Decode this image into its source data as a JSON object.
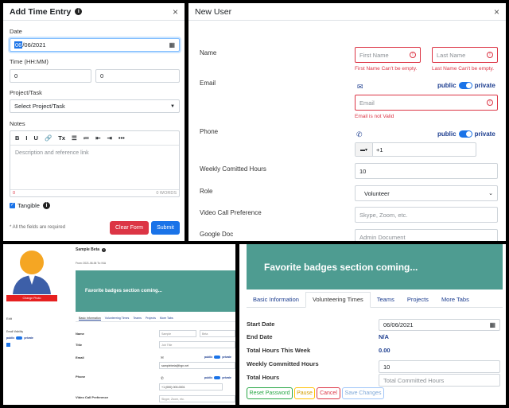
{
  "time_entry": {
    "title": "Add Time Entry",
    "close": "×",
    "date_label": "Date",
    "date_day": "06",
    "date_rest": "/06/2021",
    "time_label": "Time (HH:MM)",
    "hours": "0",
    "minutes": "0",
    "project_label": "Project/Task",
    "project_placeholder": "Select Project/Task",
    "notes_label": "Notes",
    "notes_placeholder": "Description and reference link",
    "char_count": "0",
    "word_count": "0 WORDS",
    "tangible_label": "Tangible",
    "required_note": "* All the fields are required",
    "clear_label": "Clear Form",
    "submit_label": "Submit",
    "toolbar": [
      "B",
      "I",
      "U",
      "🔗",
      "Tx",
      "☰",
      "≔",
      "⇤",
      "⇥",
      "•••"
    ]
  },
  "new_user": {
    "title": "New User",
    "close": "×",
    "name_label": "Name",
    "first_placeholder": "First Name",
    "last_placeholder": "Last Name",
    "first_error": "First Name Can't be empty.",
    "last_error": "Last Name Can't be empty.",
    "email_label": "Email",
    "public_label": "public",
    "private_label": "private",
    "email_placeholder": "Email",
    "email_error": "Email is not Valid",
    "phone_label": "Phone",
    "phone_code": "+1",
    "weekly_label": "Weekly Comitted Hours",
    "weekly_value": "10",
    "role_label": "Role",
    "role_value": "Volunteer",
    "video_label": "Video Call Preference",
    "video_placeholder": "Skype, Zoom, etc.",
    "gdoc_label": "Google Doc",
    "gdoc_placeholder": "Admin Document"
  },
  "profile_small": {
    "change_photo": "Change Photo",
    "name": "Sample Beta",
    "joined": "From: 2021-06-06 To: N/A",
    "badges_text": "Favorite badges section coming...",
    "tabs": [
      "Basic Information",
      "Volunteering Times",
      "Teams",
      "Projects",
      "More Tabs"
    ],
    "rows": [
      "Name",
      "Title",
      "Email",
      "Phone",
      "Video Call Preference"
    ],
    "first": "Sample",
    "last": "Beta",
    "title_ph": "Job Title",
    "email_val": "samplebeta@hgn.net",
    "phone_val": "+1 (000) 000-0001",
    "video_ph": "Skype, Zoom, etc.",
    "public_label": "public",
    "private_label": "private",
    "side_items": [
      "Edit",
      "Blue Square",
      "Email Visibility"
    ]
  },
  "profile_large": {
    "badges_text": "Favorite badges section coming...",
    "tabs": [
      "Basic Information",
      "Volunteering Times",
      "Teams",
      "Projects",
      "More Tabs"
    ],
    "start_label": "Start Date",
    "start_value": "06/06/2021",
    "end_label": "End Date",
    "end_value": "N/A",
    "total_week_label": "Total Hours This Week",
    "total_week_value": "0.00",
    "weekly_label": "Weekly Committed Hours",
    "weekly_value": "10",
    "total_label": "Total Hours",
    "total_placeholder": "Total Committed Hours",
    "buttons": [
      "Reset Password",
      "Pause",
      "Cancel",
      "Save Changes"
    ]
  },
  "colors": {
    "teal": "#4e9c91",
    "danger": "#dc3545",
    "primary": "#1a73e8"
  }
}
